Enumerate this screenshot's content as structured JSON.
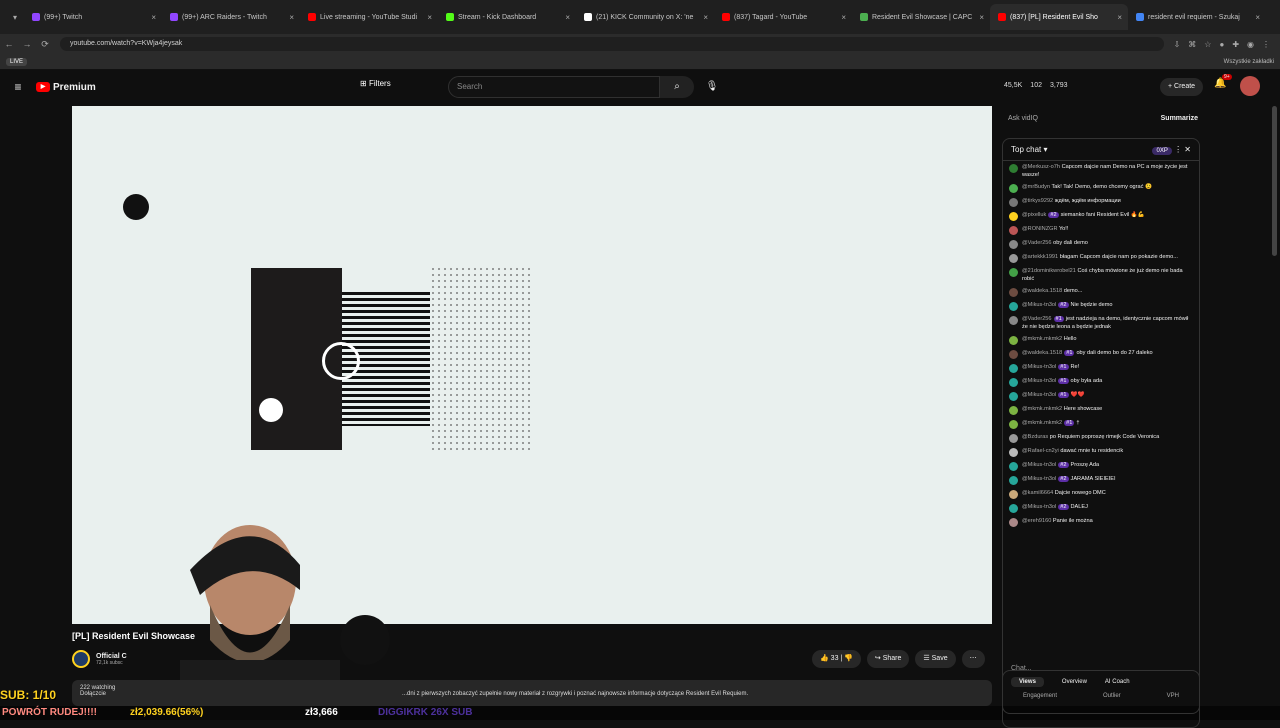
{
  "browser": {
    "tabs": [
      {
        "label": "(99+) Twitch",
        "color": "#9146ff"
      },
      {
        "label": "(99+) ARC Raiders - Twitch",
        "color": "#9146ff"
      },
      {
        "label": "Live streaming - YouTube Studi",
        "color": "#ff0000"
      },
      {
        "label": "Stream - Kick Dashboard",
        "color": "#53fc18"
      },
      {
        "label": "(21) KICK Community on X: 'ne",
        "color": "#ffffff"
      },
      {
        "label": "(837) Tagard - YouTube",
        "color": "#ff0000"
      },
      {
        "label": "Resident Evil Showcase | CAPC",
        "color": "#4caf50"
      },
      {
        "label": "(837) [PL] Resident Evil Sho",
        "color": "#ff0000"
      },
      {
        "label": "resident evil requiem - Szukaj",
        "color": "#4285f4"
      }
    ],
    "url": "youtube.com/watch?v=KWja4jeysak",
    "bookmarks_right": "Wszystkie zakładki",
    "live_badge": "LIVE"
  },
  "header": {
    "brand": "Premium",
    "filters": "Filters",
    "search_placeholder": "Search",
    "stats": [
      "45,5K",
      "102",
      "3,793"
    ],
    "create": "Create",
    "notif_count": "9+"
  },
  "video": {
    "title": "[PL] Resident Evil Showcase",
    "channel": "Official C",
    "subs": "72,1k subsc",
    "likes": "33",
    "share": "Share",
    "save": "Save",
    "watching": "222 watching",
    "join": "Dołączcie",
    "description": "...dni z pierwszych zobaczyć zupełnie nowy materiał z rozgrywki i poznać najnowsze informacje dotyczące Resident Evil Requiem."
  },
  "overlay": {
    "sub_goal": "SUB: 1/10",
    "bar_items": [
      "POWRÓT RUDEJ!!!!",
      "zł2,039.66(56%)",
      "zł3,666",
      "DIGGIKRK 26X SUB"
    ]
  },
  "sidebar": {
    "ask": "Ask vidIQ",
    "summarize": "Summarize",
    "chat_title": "Top chat",
    "xp": "0XP",
    "chat_placeholder": "Chat...",
    "tabs": [
      "Views",
      "Overview",
      "AI Coach"
    ],
    "tabs2": [
      "Engagement",
      "Outlier",
      "VPH"
    ]
  },
  "chat": [
    {
      "user": "@Merkusz-o7h",
      "text": "Capcom dajcie nam Demo na PC a moje życie jest wasze!",
      "badge": "",
      "color": "#2e7d32"
    },
    {
      "user": "@mrBudyn",
      "text": "Tak! Tak! Demo, demo chcemy ograć 😉",
      "badge": "",
      "color": "#4caf50"
    },
    {
      "user": "@tirkys9292",
      "text": "ждём, ждём информации",
      "badge": "",
      "color": "#777"
    },
    {
      "user": "@pixelluk",
      "text": "siemanko fani Resident Evil 🔥💪",
      "badge": "#2",
      "color": "#ffd21f"
    },
    {
      "user": "@RONINZGR",
      "text": "Yo!!",
      "badge": "",
      "color": "#b55"
    },
    {
      "user": "@Vader256",
      "text": "oby dali demo",
      "badge": "",
      "color": "#888"
    },
    {
      "user": "@artekkk1991",
      "text": "błagam Capcom dajcie nam po pokazie demo...",
      "badge": "",
      "color": "#999"
    },
    {
      "user": "@21dominikwrobel21",
      "text": "Coś chyba mówione że już demo nie bada robić",
      "badge": "",
      "color": "#43a047"
    },
    {
      "user": "@waldeka.1518",
      "text": "demo...",
      "badge": "",
      "color": "#6d4c41"
    },
    {
      "user": "@Mikus-tn3ol",
      "text": "Nie będzie demo",
      "badge": "#2",
      "color": "#26a69a"
    },
    {
      "user": "@Vader256",
      "text": "jest nadzieja na demo, identycznie capcom mówił że nie będzie leona a będzie jednak",
      "badge": "#1",
      "color": "#888"
    },
    {
      "user": "@mkmk.mkmk2",
      "text": "Hello",
      "badge": "",
      "color": "#7cb342"
    },
    {
      "user": "@waldeka.1518",
      "text": "oby dali demo bo do 27 daleko",
      "badge": "#1",
      "color": "#6d4c41"
    },
    {
      "user": "@Mikus-tn3ol",
      "text": "Re!",
      "badge": "#1",
      "color": "#26a69a"
    },
    {
      "user": "@Mikus-tn3ol",
      "text": "oby była ada",
      "badge": "#1",
      "color": "#26a69a"
    },
    {
      "user": "@Mikus-tn3ol",
      "text": "❤️❤️",
      "badge": "#1",
      "color": "#26a69a"
    },
    {
      "user": "@mkmk.mkmk2",
      "text": "Here showcase",
      "badge": "",
      "color": "#7cb342"
    },
    {
      "user": "@mkmk.mkmk2",
      "text": "†",
      "badge": "#1",
      "color": "#7cb342"
    },
    {
      "user": "@Bzduras",
      "text": "po Requiem poproszę rimejk Code Veronica",
      "badge": "",
      "color": "#999"
    },
    {
      "user": "@Rafael-cn2yi",
      "text": "dawać mnie tu residencik",
      "badge": "",
      "color": "#bbb"
    },
    {
      "user": "@Mikus-tn3ol",
      "text": "Proszę Ada",
      "badge": "#2",
      "color": "#26a69a"
    },
    {
      "user": "@Mikus-tn3ol",
      "text": "JARAMA SIEIEIEI",
      "badge": "#2",
      "color": "#26a69a"
    },
    {
      "user": "@kamil6664",
      "text": "Dajcie nowego DMC",
      "badge": "",
      "color": "#c9a87a"
    },
    {
      "user": "@Mikus-tn3ol",
      "text": "DALEJ",
      "badge": "#2",
      "color": "#26a69a"
    },
    {
      "user": "@ereh9160",
      "text": "Panie ile można",
      "badge": "",
      "color": "#a88"
    }
  ]
}
